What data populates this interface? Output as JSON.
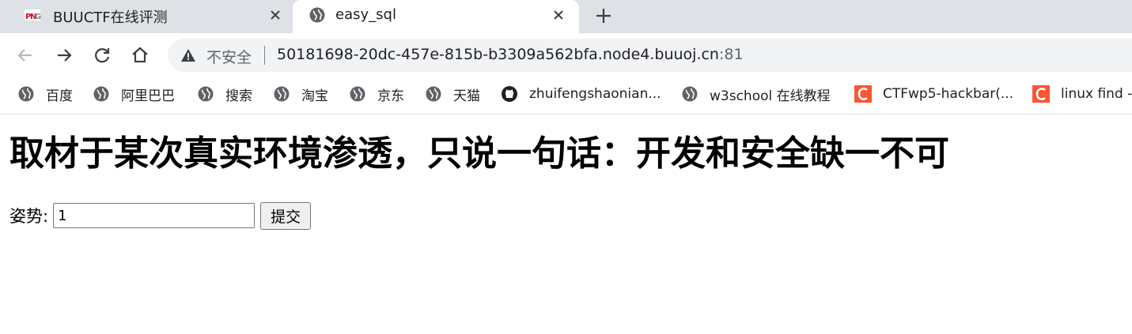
{
  "browser": {
    "tabs": [
      {
        "title": "BUUCTF在线评测",
        "favicon": "buuctf-logo-icon",
        "active": false
      },
      {
        "title": "easy_sql",
        "favicon": "globe-icon",
        "active": true
      }
    ],
    "address_bar": {
      "security_label": "不安全",
      "url_host": "50181698-20dc-457e-815b-b3309a562bfa.node4.buuoj.cn",
      "url_port": ":81"
    },
    "bookmarks": [
      {
        "label": "百度",
        "icon": "globe-icon"
      },
      {
        "label": "阿里巴巴",
        "icon": "globe-icon"
      },
      {
        "label": "搜索",
        "icon": "globe-icon"
      },
      {
        "label": "淘宝",
        "icon": "globe-icon"
      },
      {
        "label": "京东",
        "icon": "globe-icon"
      },
      {
        "label": "天猫",
        "icon": "globe-icon"
      },
      {
        "label": "zhuifengshaonian...",
        "icon": "github-icon"
      },
      {
        "label": "w3school 在线教程",
        "icon": "globe-icon"
      },
      {
        "label": "CTFwp5-hackbar(...",
        "icon": "csdn-icon"
      },
      {
        "label": "linux find -",
        "icon": "csdn-icon"
      }
    ]
  },
  "page": {
    "heading": "取材于某次真实环境渗透，只说一句话：开发和安全缺一不可",
    "form": {
      "label": "姿势:",
      "input_value": "1",
      "submit_label": "提交"
    }
  },
  "colors": {
    "tabstrip_bg": "#dee1e6",
    "omnibox_bg": "#f1f3f4",
    "csdn_orange": "#fc5531",
    "buuctf_red": "#c8102e"
  }
}
